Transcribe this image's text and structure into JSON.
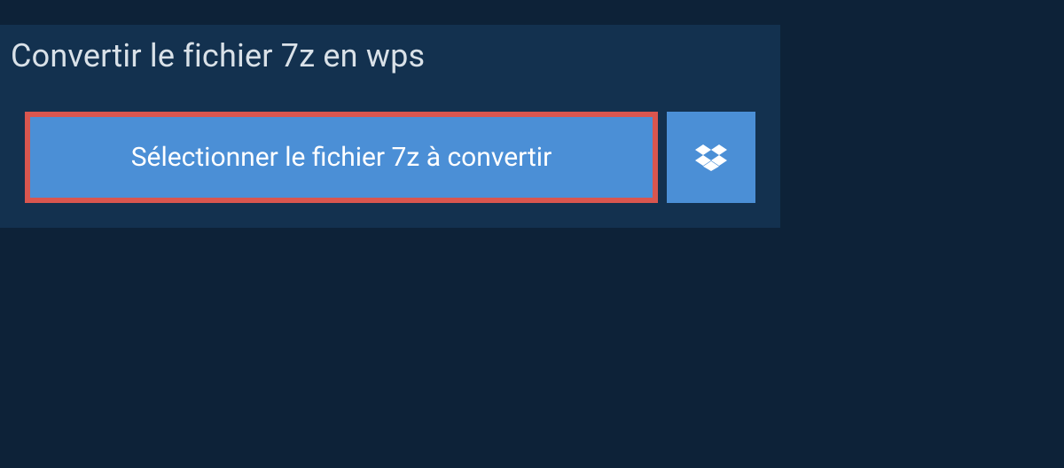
{
  "title": "Convertir le fichier 7z en wps",
  "buttons": {
    "select_label": "Sélectionner le fichier 7z à convertir"
  }
}
